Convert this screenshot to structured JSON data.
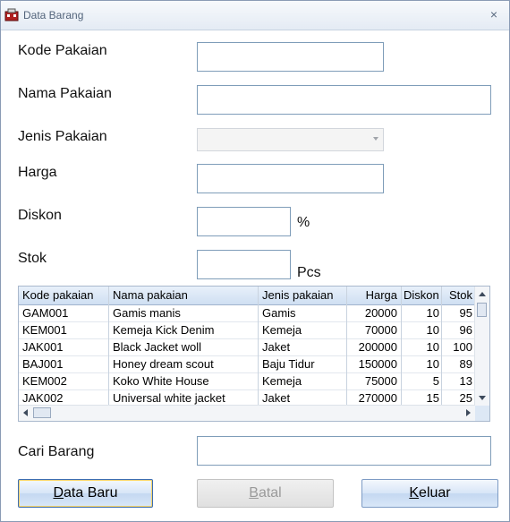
{
  "window": {
    "title": "Data Barang",
    "close_glyph": "×",
    "icon": "app-icon"
  },
  "form": {
    "kode_label": "Kode Pakaian",
    "kode_value": "",
    "nama_label": "Nama Pakaian",
    "nama_value": "",
    "jenis_label": "Jenis Pakaian",
    "jenis_value": "",
    "harga_label": "Harga",
    "harga_value": "",
    "diskon_label": "Diskon",
    "diskon_value": "",
    "diskon_unit": "%",
    "stok_label": "Stok",
    "stok_value": "",
    "stok_unit": "Pcs"
  },
  "table": {
    "columns": [
      "Kode pakaian",
      "Nama pakaian",
      "Jenis pakaian",
      "Harga",
      "Diskon",
      "Stok"
    ],
    "rows": [
      [
        "GAM001",
        "Gamis manis",
        "Gamis",
        "20000",
        "10",
        "95"
      ],
      [
        "KEM001",
        "Kemeja Kick Denim",
        "Kemeja",
        "70000",
        "10",
        "96"
      ],
      [
        "JAK001",
        "Black Jacket woll",
        "Jaket",
        "200000",
        "10",
        "100"
      ],
      [
        "BAJ001",
        "Honey dream scout",
        "Baju Tidur",
        "150000",
        "10",
        "89"
      ],
      [
        "KEM002",
        "Koko White House",
        "Kemeja",
        "75000",
        "5",
        "13"
      ],
      [
        "JAK002",
        "Universal white jacket",
        "Jaket",
        "270000",
        "15",
        "25"
      ]
    ]
  },
  "search": {
    "label": "Cari Barang",
    "value": ""
  },
  "buttons": {
    "data_baru": {
      "first": "D",
      "rest": "ata Baru"
    },
    "batal": {
      "first": "B",
      "rest": "atal"
    },
    "keluar": {
      "first": "K",
      "rest": "eluar"
    }
  },
  "colors": {
    "accent": "#7d9bc4",
    "window_border": "#8a9bb5"
  }
}
